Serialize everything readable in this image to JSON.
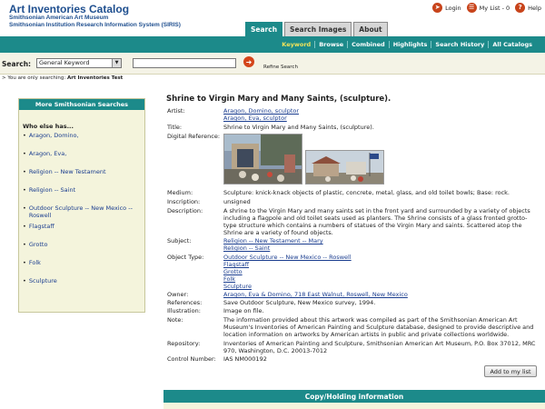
{
  "header": {
    "title": "Art Inventories Catalog",
    "subtitle1": "Smithsonian American Art Museum",
    "subtitle2": "Smithsonian Institution Research Information System (SIRIS)",
    "login": "Login",
    "my_list": "My List - 0",
    "help": "Help"
  },
  "tabs": [
    {
      "label": "Search",
      "active": true
    },
    {
      "label": "Search Images",
      "active": false
    },
    {
      "label": "About",
      "active": false
    }
  ],
  "subnav": [
    {
      "label": "Keyword",
      "active": true
    },
    {
      "label": "Browse",
      "active": false
    },
    {
      "label": "Combined",
      "active": false
    },
    {
      "label": "Highlights",
      "active": false
    },
    {
      "label": "Search History",
      "active": false
    },
    {
      "label": "All Catalogs",
      "active": false
    }
  ],
  "search": {
    "label": "Search:",
    "select_value": "General Keyword",
    "input_value": "",
    "refine": "Refine Search"
  },
  "scope": {
    "prefix": "> You are only searching:",
    "value": "Art Inventories Test"
  },
  "sidebar": {
    "heading": "More Smithsonian Searches",
    "who_else": "Who else has...",
    "items": [
      "Aragon, Domino,",
      "Aragon, Eva,",
      "Religion -- New Testament",
      "Religion -- Saint",
      "Outdoor Sculpture -- New Mexico -- Roswell",
      "Flagstaff",
      "Grotto",
      "Folk",
      "Sculpture"
    ]
  },
  "record": {
    "title": "Shrine to Virgin Mary and Many Saints, (sculpture).",
    "labels": {
      "artist": "Artist:",
      "title": "Title:",
      "digital": "Digital Reference:",
      "medium": "Medium:",
      "inscription": "Inscription:",
      "description": "Description:",
      "subject": "Subject:",
      "object_type": "Object Type:",
      "owner": "Owner:",
      "references": "References:",
      "illustration": "Illustration:",
      "note": "Note:",
      "repository": "Repository:",
      "control": "Control Number:"
    },
    "artist": [
      "Aragon, Domino, sculptor",
      "Aragon, Eva, sculptor"
    ],
    "title_value": "Shrine to Virgin Mary and Many Saints, (sculpture).",
    "medium": "Sculpture: knick-knack objects of plastic, concrete, metal, glass, and old toilet bowls; Base: rock.",
    "inscription": "unsigned",
    "description": "A shrine to the Virgin Mary and many saints set in the front yard and surrounded by a variety of objects including a flagpole and old toilet seats used as planters. The Shrine consists of a glass fronted grotto-type structure which contains a numbers of statues of the Virgin Mary and saints. Scattered atop the Shrine are a variety of found objects.",
    "subject": [
      "Religion -- New Testament -- Mary",
      "Religion -- Saint"
    ],
    "object_type": [
      "Outdoor Sculpture -- New Mexico -- Roswell",
      "Flagstaff",
      "Grotto",
      "Folk",
      "Sculpture"
    ],
    "owner": "Aragon, Eva & Domino, 718 East Walnut, Roswell, New Mexico",
    "references": "Save Outdoor Sculpture, New Mexico survey, 1994.",
    "illustration": "Image on file.",
    "note": "The information provided about this artwork was compiled as part of the Smithsonian American Art Museum's Inventories of American Painting and Sculpture database, designed to provide descriptive and location information on artworks by American artists in public and private collections worldwide.",
    "repository": "Inventories of American Painting and Sculpture, Smithsonian American Art Museum, P.O. Box 37012, MRC 970, Washington, D.C. 20013-7012",
    "control": "IAS NM000192"
  },
  "add_button": "Add to my list",
  "copy_holding": "Copy/Holding information"
}
